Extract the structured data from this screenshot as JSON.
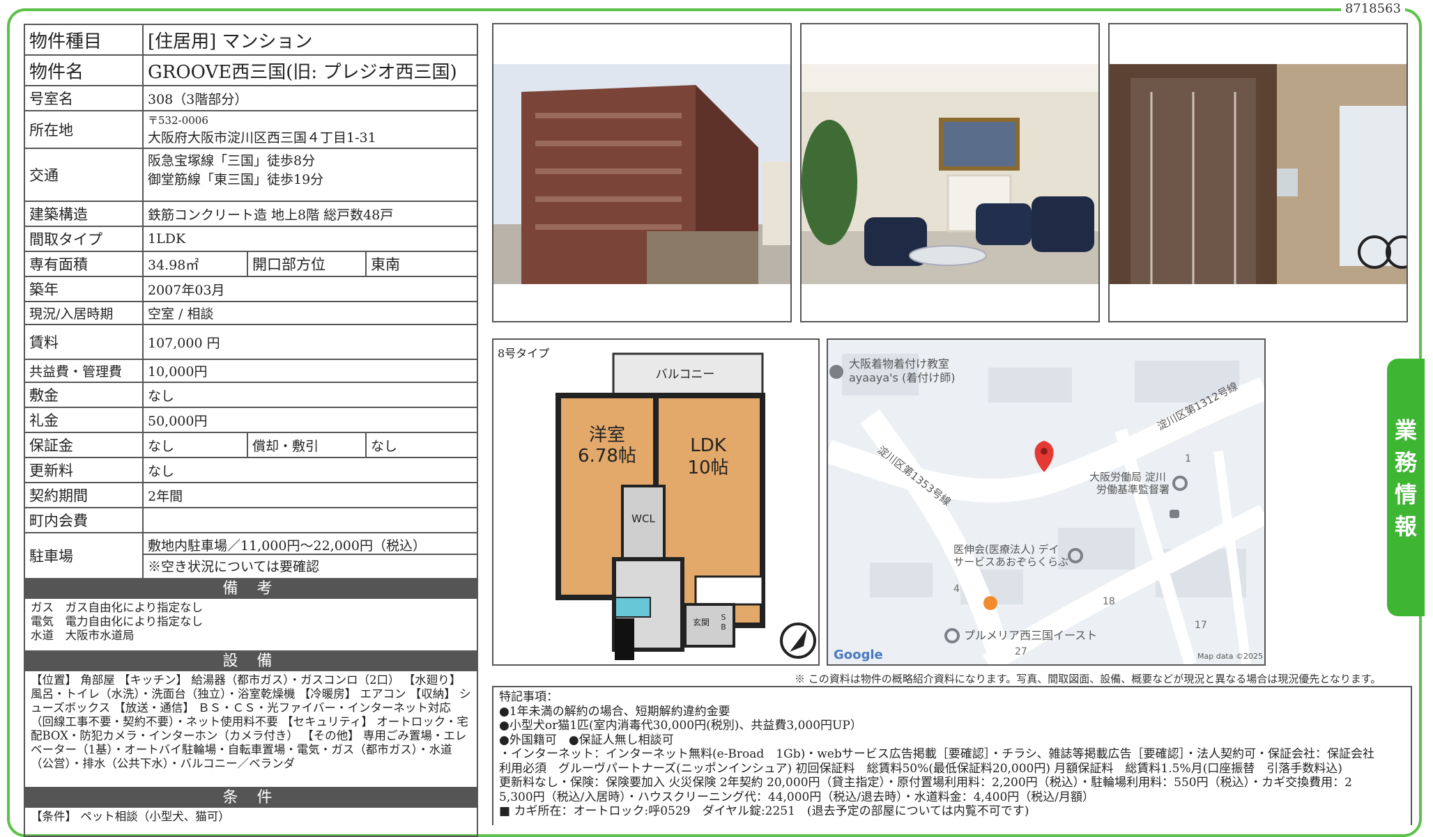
{
  "doc_id": "8718563",
  "spec": {
    "type_k": "物件種目",
    "type_v": "[住居用] マンション",
    "name_k": "物件名",
    "name_v": "GROOVE西三国(旧: プレジオ西三国)",
    "room_k": "号室名",
    "room_v": "308（3階部分）",
    "addr_k": "所在地",
    "addr_zip": "〒532-0006",
    "addr_v": "大阪府大阪市淀川区西三国４丁目1-31",
    "access_k": "交通",
    "access_1": "阪急宝塚線「三国」徒歩8分",
    "access_2": "御堂筋線「東三国」徒歩19分",
    "struct_k": "建築構造",
    "struct_v": "鉄筋コンクリート造 地上8階 総戸数48戸",
    "layout_k": "間取タイプ",
    "layout_v": "1LDK",
    "area_k": "専有面積",
    "area_v": "34.98㎡",
    "dir_k": "開口部方位",
    "dir_v": "東南",
    "built_k": "築年",
    "built_v": "2007年03月",
    "status_k": "現況/入居時期",
    "status_v": "空室 / 相談",
    "rent_k": "賃料",
    "rent_v": "107,000 円",
    "fee_k": "共益費・管理費",
    "fee_v": "10,000円",
    "deposit_k": "敷金",
    "deposit_v": "なし",
    "key_k": "礼金",
    "key_v": "50,000円",
    "guar_k": "保証金",
    "guar_v": "なし",
    "amort_k": "償却・敷引",
    "amort_v": "なし",
    "renew_k": "更新料",
    "renew_v": "なし",
    "term_k": "契約期間",
    "term_v": "2年間",
    "town_k": "町内会費",
    "town_v": "",
    "park_k": "駐車場",
    "park_v": "敷地内駐車場／11,000円～22,000円（税込）",
    "park_note": "※空き状況については要確認"
  },
  "remarks": {
    "title": "備 考",
    "lines": [
      "ガス　ガス自由化により指定なし",
      "電気　電力自由化により指定なし",
      "水道　大阪市水道局"
    ]
  },
  "equipment": {
    "title": "設 備",
    "text": "【位置】 角部屋 【キッチン】 給湯器（都市ガス）・ガスコンロ（2口） 【水廻り】 風呂・トイレ（水洗）・洗面台（独立）・浴室乾燥機 【冷暖房】 エアコン 【収納】 シューズボックス 【放送・通信】 ＢＳ・ＣＳ・光ファイバー・インターネット対応（回線工事不要・契約不要）・ネット使用料不要 【セキュリティ】 オートロック・宅配BOX・防犯カメラ・インターホン（カメラ付き） 【その他】 専用ごみ置場・エレベーター（1基）・オートバイ駐輪場・自転車置場・電気・ガス（都市ガス）・水道（公営）・排水（公共下水）・バルコニー／ベランダ"
  },
  "conditions": {
    "title": "条 件",
    "text": "【条件】 ペット相談（小型犬、猫可）"
  },
  "floorplan": {
    "label": "8号タイプ",
    "balcony": "バルコニー",
    "room1": "洋室",
    "room1_size": "6.78帖",
    "room2": "LDK",
    "room2_size": "10帖",
    "wcl": "WCL",
    "entrance": "玄関",
    "sb1": "S",
    "sb2": "B"
  },
  "map": {
    "poi1a": "大阪着物着付け教室",
    "poi1b": "ayaaya's (着付け師)",
    "road1": "淀川区第1312号線",
    "road2": "淀川区第1353号線",
    "poi2a": "大阪労働局 淀川",
    "poi2b": "労働基準監督署",
    "poi3a": "医伸会(医療法人) デイ",
    "poi3b": "サービスあおぞらくらぶ",
    "poi4": "プルメリア西三国イースト",
    "n1": "1",
    "n4": "4",
    "n18": "18",
    "n17": "17",
    "n27": "27",
    "logo": "Google",
    "copyright": "Map data ©2025"
  },
  "disclaimer": "※ この資料は物件の概略紹介資料になります。写真、間取図面、設備、概要などが現況と異なる場合は現況優先となります。",
  "notes": {
    "lines": [
      "特記事項：",
      "●1年未満の解約の場合、短期解約違約金要",
      "●小型犬or猫1匹(室内消毒代30,000円(税別)、共益費3,000円UP）",
      "●外国籍可　●保証人無し相談可",
      "・インターネット：インターネット無料(e-Broad　1Gb)・webサービス広告掲載［要確認］・チラシ、雑誌等掲載広告［要確認］・法人契約可・保証会社：保証会社",
      "利用必須　グルーヴパートナーズ(ニッポンインシュア) 初回保証料　総賃料50%(最低保証料20,000円) 月額保証料　総賃料1.5%月(口座振替　引落手数料込)",
      "更新料なし・保険：保険要加入 火災保険 2年契約 20,000円（貸主指定）・原付置場利用料：2,200円（税込）・駐輪場利用料：550円（税込）・カギ交換費用：2",
      "5,300円（税込/入居時）・ハウスクリーニング代：44,000円（税込/退去時）・水道料金：4,400円（税込/月額）",
      "■ カギ所在：オートロック:呼0529　ダイヤル錠:2251　(退去予定の部屋については内覧不可です)"
    ]
  },
  "side_tab": [
    "業",
    "務",
    "情",
    "報"
  ]
}
